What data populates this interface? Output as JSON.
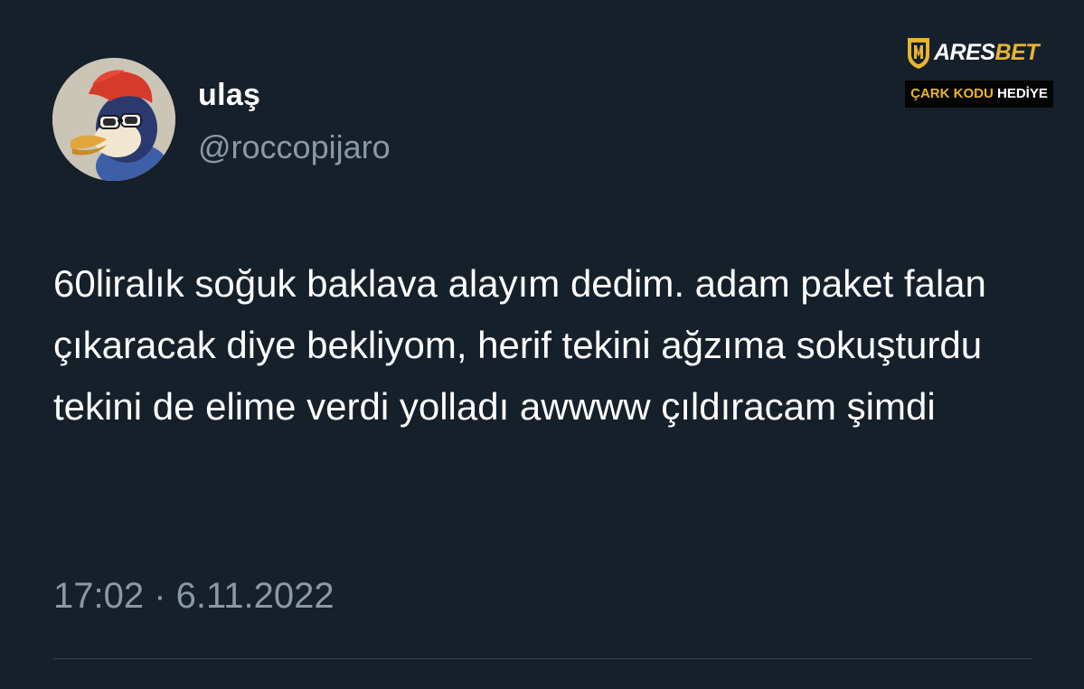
{
  "tweet": {
    "display_name": "ulaş",
    "handle": "@roccopijaro",
    "text": "60liralık soğuk baklava alayım dedim. adam paket falan çıkaracak diye bekliyom, herif tekini ağzıma sokuşturdu tekini de elime verdi yolladı awwww çıldıracam şimdi",
    "timestamp": "17:02 · 6.11.2022"
  },
  "watermark": {
    "brand_part1": "ARES",
    "brand_part2": "BET",
    "banner_part1": "ÇARK KODU",
    "banner_part2": "HEDİYE",
    "accent_color": "#e8b530"
  },
  "colors": {
    "background": "#15202b",
    "primary_text": "#ffffff",
    "secondary_text": "#8b98a5",
    "divider": "#38444d"
  },
  "icons": {
    "avatar": "woodpecker-avatar",
    "watermark_emblem": "helmet-emblem-icon"
  }
}
